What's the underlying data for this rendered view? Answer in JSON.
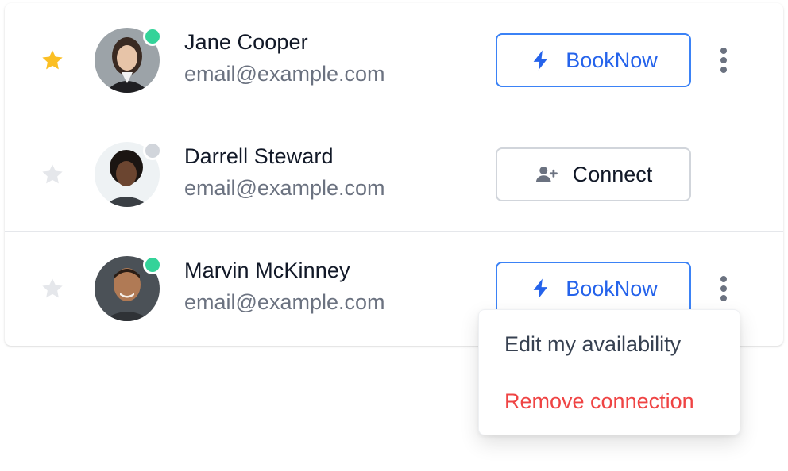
{
  "contacts": [
    {
      "name": "Jane Cooper",
      "email": "email@example.com",
      "starred": true,
      "online": true,
      "action": {
        "type": "book",
        "label": "BookNow"
      },
      "has_menu": true
    },
    {
      "name": "Darrell Steward",
      "email": "email@example.com",
      "starred": false,
      "online": false,
      "action": {
        "type": "connect",
        "label": "Connect"
      },
      "has_menu": false
    },
    {
      "name": "Marvin McKinney",
      "email": "email@example.com",
      "starred": false,
      "online": true,
      "action": {
        "type": "book",
        "label": "BookNow"
      },
      "has_menu": true
    }
  ],
  "menu": {
    "items": [
      {
        "label": "Edit my availability",
        "color": "#374151"
      },
      {
        "label": "Remove connection",
        "color": "#ef4444"
      }
    ]
  },
  "colors": {
    "star_on": "#fbbf24",
    "star_off": "#e5e7eb",
    "online": "#34d399",
    "offline": "#d1d5db",
    "primary": "#2563eb"
  },
  "icons": {
    "star": "star-icon",
    "book": "lightning-bolt-icon",
    "connect": "user-plus-icon",
    "menu": "more-vertical-icon"
  }
}
